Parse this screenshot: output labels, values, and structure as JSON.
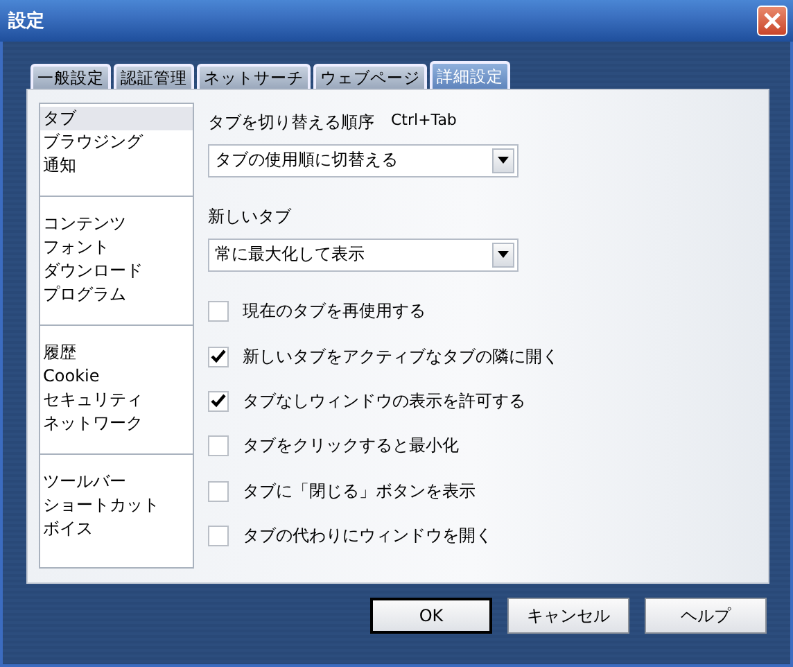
{
  "window": {
    "title": "設定"
  },
  "tabs": [
    {
      "label": "一般設定",
      "selected": false
    },
    {
      "label": "認証管理",
      "selected": false
    },
    {
      "label": "ネットサーチ",
      "selected": false
    },
    {
      "label": "ウェブページ",
      "selected": false
    },
    {
      "label": "詳細設定",
      "selected": true
    }
  ],
  "sidebar": {
    "groups": [
      {
        "items": [
          {
            "label": "タブ",
            "selected": true
          },
          {
            "label": "ブラウジング",
            "selected": false
          },
          {
            "label": "通知",
            "selected": false
          }
        ]
      },
      {
        "items": [
          {
            "label": "コンテンツ",
            "selected": false
          },
          {
            "label": "フォント",
            "selected": false
          },
          {
            "label": "ダウンロード",
            "selected": false
          },
          {
            "label": "プログラム",
            "selected": false
          }
        ]
      },
      {
        "items": [
          {
            "label": "履歴",
            "selected": false
          },
          {
            "label": "Cookie",
            "selected": false
          },
          {
            "label": "セキュリティ",
            "selected": false
          },
          {
            "label": "ネットワーク",
            "selected": false
          }
        ]
      },
      {
        "items": [
          {
            "label": "ツールバー",
            "selected": false
          },
          {
            "label": "ショートカット",
            "selected": false
          },
          {
            "label": "ボイス",
            "selected": false
          }
        ]
      }
    ]
  },
  "settings": [
    {
      "kind": "dropdown",
      "label": "タブを切り替える順序",
      "shortcut": "Ctrl+Tab",
      "value": "タブの使用順に切替える"
    },
    {
      "kind": "dropdown",
      "label": "新しいタブ",
      "value": "常に最大化して表示"
    },
    {
      "kind": "checkbox",
      "label": "現在のタブを再使用する",
      "checked": false
    },
    {
      "kind": "checkbox",
      "label": "新しいタブをアクティブなタブの隣に開く",
      "checked": true
    },
    {
      "kind": "checkbox",
      "label": "タブなしウィンドウの表示を許可する",
      "checked": true
    },
    {
      "kind": "checkbox",
      "label": "タブをクリックすると最小化",
      "checked": false
    },
    {
      "kind": "checkbox",
      "label": "タブに「閉じる」ボタンを表示",
      "checked": false
    },
    {
      "kind": "checkbox",
      "label": "タブの代わりにウィンドウを開く",
      "checked": false
    }
  ],
  "buttons": [
    {
      "label": "OK",
      "default": true
    },
    {
      "label": "キャンセル",
      "default": false
    },
    {
      "label": "ヘルプ",
      "default": false
    }
  ]
}
